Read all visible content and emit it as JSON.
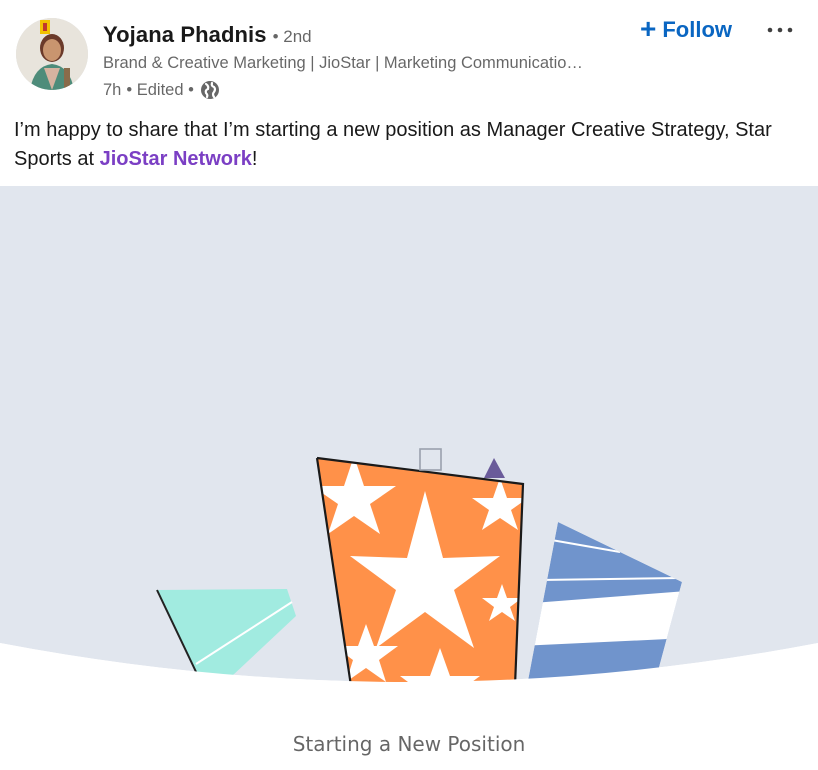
{
  "author": {
    "name": "Yojana Phadnis",
    "degree": "• 2nd",
    "headline": "Brand & Creative Marketing | JioStar | Marketing Communicatio…",
    "time": "7h",
    "edited": "• Edited •",
    "visibility_icon": "globe-icon"
  },
  "actions": {
    "follow_label": "Follow",
    "follow_icon": "plus-icon",
    "more_icon": "ellipsis-icon"
  },
  "post": {
    "text_before": "I’m happy to share that I’m starting a new position as Manager Creative Strategy, Star Sports at ",
    "mention": "JioStar Network",
    "text_after": "!"
  },
  "media": {
    "caption": "Starting a New Position",
    "background_color": "#e1e6ee",
    "accent_orange": "#ff9149",
    "accent_teal": "#a1ebe0",
    "accent_blue": "#7094cc",
    "accent_purple": "#6a5b9a"
  },
  "colors": {
    "follow_blue": "#0a66c2",
    "mention_purple": "#7b3fc4"
  }
}
